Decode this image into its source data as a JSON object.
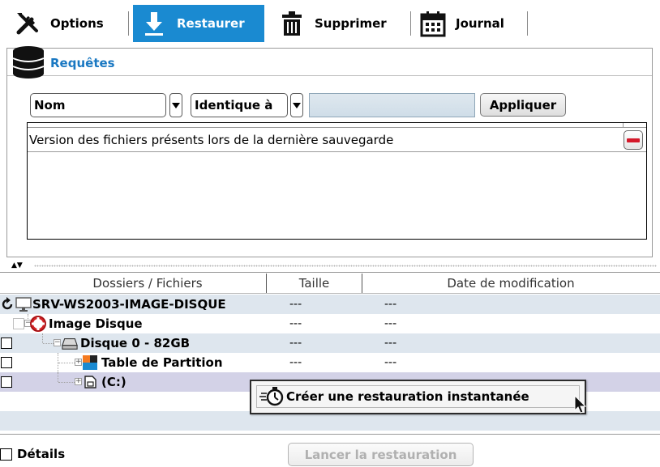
{
  "tabs": [
    {
      "label": "Options",
      "icon": "tools-icon"
    },
    {
      "label": "Restaurer",
      "icon": "download-icon",
      "active": true
    },
    {
      "label": "Supprimer",
      "icon": "trash-icon"
    },
    {
      "label": "Journal",
      "icon": "calendar-icon"
    }
  ],
  "requetes": {
    "title": "Requêtes",
    "field_select": "Nom",
    "operator_select": "Identique à",
    "value": "",
    "apply_label": "Appliquer",
    "entries": [
      "Version des fichiers présents lors de la dernière sauvegarde"
    ]
  },
  "splitter": {
    "arrows": "▲▼"
  },
  "tree": {
    "columns": [
      "Dossiers / Fichiers",
      "Taille",
      "Date de modification"
    ],
    "rows": [
      {
        "name": "SRV-WS2003-IMAGE-DISQUE",
        "size": "---",
        "date": "---",
        "icon": "computer-icon"
      },
      {
        "name": "Image Disque",
        "size": "---",
        "date": "---",
        "icon": "lifebuoy-icon"
      },
      {
        "name": "Disque 0 - 82GB",
        "size": "---",
        "date": "---",
        "icon": "hard-drive-icon"
      },
      {
        "name": "Table de Partition",
        "size": "---",
        "date": "---",
        "icon": "partition-table-icon"
      },
      {
        "name": "(C:)",
        "size": "",
        "date": "",
        "icon": "volume-icon"
      }
    ]
  },
  "context_menu": {
    "item": "Créer une restauration instantanée"
  },
  "footer": {
    "details_label": "Détails",
    "launch_label": "Lancer la restauration"
  },
  "colors": {
    "accent": "#1a8ad1",
    "row_alt": "#dee6ee",
    "row_selected": "#d3d2e7",
    "remove": "#d4182a"
  }
}
